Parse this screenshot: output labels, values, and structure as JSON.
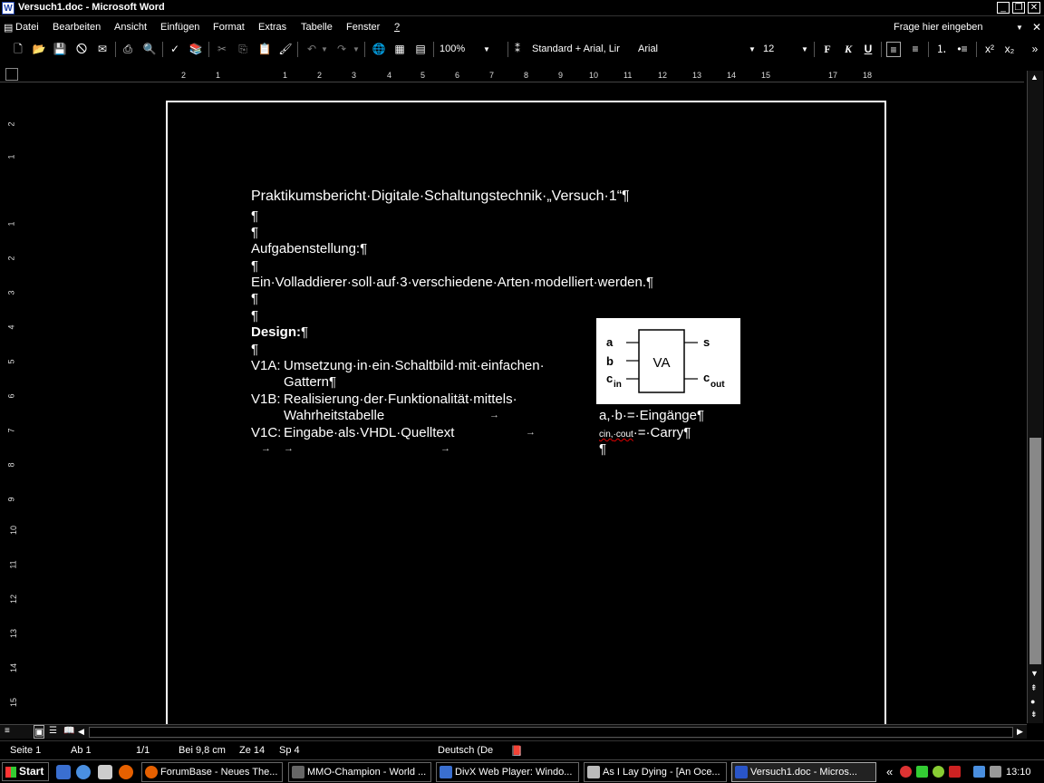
{
  "window": {
    "title": "Versuch1.doc - Microsoft Word",
    "app_icon": "W"
  },
  "menu": {
    "items": [
      "Datei",
      "Bearbeiten",
      "Ansicht",
      "Einfügen",
      "Format",
      "Extras",
      "Tabelle",
      "Fenster",
      "?"
    ],
    "help_placeholder": "Frage hier eingeben"
  },
  "toolbar": {
    "zoom": "100%",
    "style": "Standard + Arial, Lir",
    "font": "Arial",
    "size": "12"
  },
  "ruler": {
    "h_ticks": [
      "2",
      "1",
      "1",
      "2",
      "3",
      "4",
      "5",
      "6",
      "7",
      "8",
      "9",
      "10",
      "11",
      "12",
      "13",
      "14",
      "15",
      "17",
      "18"
    ],
    "v_ticks": [
      "2",
      "1",
      "1",
      "2",
      "3",
      "4",
      "5",
      "6",
      "7",
      "8",
      "9",
      "10",
      "11",
      "12",
      "13",
      "14",
      "15"
    ]
  },
  "document": {
    "title": "Praktikumsbericht·Digitale·Schaltungstechnik·„Versuch·1“¶",
    "p1": "¶",
    "p2": "¶",
    "task_heading": "Aufgabenstellung:¶",
    "p3": "¶",
    "task_text": "Ein·Volladdierer·soll·auf·3·verschiedene·Arten·modelliert·werden.¶",
    "p4": "¶",
    "p5": "¶",
    "design_heading": "Design:",
    "design_pilcrow": "¶",
    "p6": "¶",
    "v1a_label": "V1A:",
    "v1a_text": "Umsetzung·in·ein·Schaltbild·mit·einfachen·",
    "v1a_cont": "Gattern¶",
    "v1b_label": "V1B:",
    "v1b_text": "Realisierung·der·Funktionalität·mittels·",
    "v1b_cont": "Wahrheitstabelle",
    "v1c_label": "V1C:",
    "v1c_text": "Eingabe·als·VHDL·Quelltext",
    "tab_arrow": "→",
    "legend_inputs": "a,·b·=·Eingänge¶",
    "legend_cin": "cin,",
    "legend_cout": "·cout",
    "legend_carry": "·=·Carry¶",
    "legend_end": "¶"
  },
  "diagram": {
    "block_label": "VA",
    "in_a": "a",
    "in_b": "b",
    "in_c": "c",
    "in_c_sub": "in",
    "out_s": "s",
    "out_c": "c",
    "out_c_sub": "out"
  },
  "status": {
    "page": "Seite  1",
    "section": "Ab  1",
    "pages": "1/1",
    "position": "Bei  9,8 cm",
    "line": "Ze  14",
    "column": "Sp  4",
    "language": "Deutsch (De"
  },
  "taskbar": {
    "start": "Start",
    "tasks": [
      "ForumBase - Neues The...",
      "MMO-Champion - World ...",
      "DivX Web Player: Windo...",
      "As I Lay Dying - [An Oce...",
      "Versuch1.doc - Micros..."
    ],
    "clock": "13:10",
    "chevron": "«"
  },
  "colors": {
    "background": "#000000",
    "text": "#ffffff",
    "firefox": "#e66000",
    "word": "#2a55c8"
  }
}
